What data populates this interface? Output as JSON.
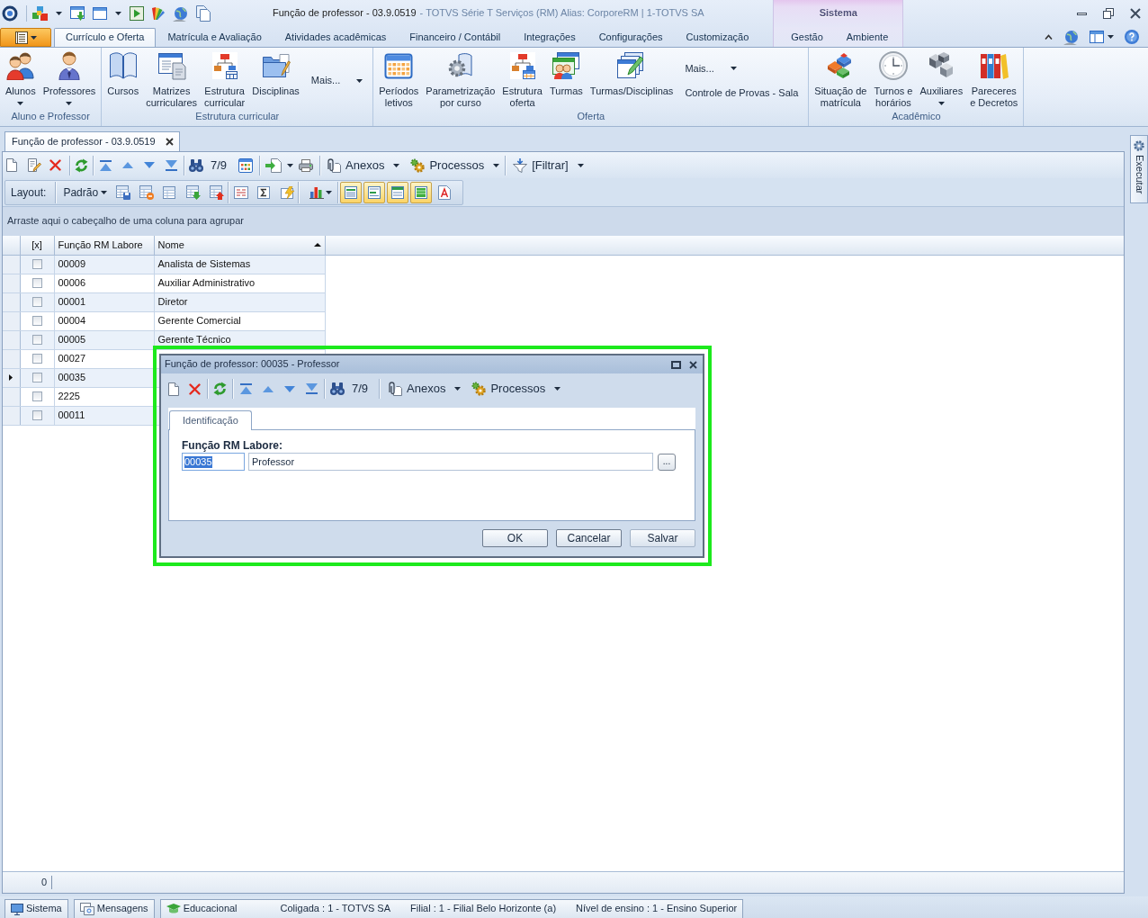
{
  "window": {
    "title": "Função de professor - 03.9.0519",
    "subtitle": "- TOTVS Série T Serviços (RM) Alias: CorporeRM | 1-TOTVS SA"
  },
  "ribbon": {
    "tabs": [
      {
        "label": "Currículo e Oferta",
        "selected": true
      },
      {
        "label": "Matrícula e Avaliação",
        "selected": false
      },
      {
        "label": "Atividades acadêmicas",
        "selected": false
      },
      {
        "label": "Financeiro / Contábil",
        "selected": false
      },
      {
        "label": "Integrações",
        "selected": false
      },
      {
        "label": "Configurações",
        "selected": false
      },
      {
        "label": "Customização",
        "selected": false
      }
    ],
    "context_group": {
      "label": "Sistema",
      "tabs": [
        {
          "label": "Gestão",
          "selected": false
        },
        {
          "label": "Ambiente",
          "selected": false
        }
      ]
    },
    "groups": [
      {
        "label": "Aluno e Professor",
        "items": [
          {
            "kind": "large",
            "label": "Alunos",
            "dropdown": true
          },
          {
            "kind": "large",
            "label": "Professores",
            "dropdown": true
          }
        ]
      },
      {
        "label": "Estrutura curricular",
        "items": [
          {
            "kind": "large",
            "label": "Cursos",
            "dropdown": false
          },
          {
            "kind": "large",
            "label": "Matrizes\ncurriculares",
            "dropdown": false
          },
          {
            "kind": "large",
            "label": "Estrutura\ncurricular",
            "dropdown": false
          },
          {
            "kind": "large",
            "label": "Disciplinas",
            "dropdown": false
          },
          {
            "kind": "stack",
            "items": [
              {
                "label": "Mais...",
                "dropdown": true
              }
            ]
          }
        ]
      },
      {
        "label": "Oferta",
        "items": [
          {
            "kind": "large",
            "label": "Períodos\nletivos",
            "dropdown": false
          },
          {
            "kind": "large",
            "label": "Parametrização\npor curso",
            "dropdown": false
          },
          {
            "kind": "large",
            "label": "Estrutura\noferta",
            "dropdown": false
          },
          {
            "kind": "large",
            "label": "Turmas",
            "dropdown": false
          },
          {
            "kind": "large",
            "label": "Turmas/Disciplinas",
            "dropdown": false
          },
          {
            "kind": "stack",
            "items": [
              {
                "label": "Mais...",
                "dropdown": true
              },
              {
                "label": "Controle de Provas - Sala",
                "dropdown": false
              }
            ]
          }
        ]
      },
      {
        "label": "Acadêmico",
        "items": [
          {
            "kind": "large",
            "label": "Situação de\nmatrícula",
            "dropdown": false
          },
          {
            "kind": "large",
            "label": "Turnos e\nhorários",
            "dropdown": false
          },
          {
            "kind": "large",
            "label": "Auxiliares",
            "dropdown": true
          },
          {
            "kind": "large",
            "label": "Pareceres\ne Decretos",
            "dropdown": false
          }
        ]
      }
    ]
  },
  "documents": [
    {
      "label": "Função de professor - 03.9.0519",
      "selected": true,
      "closable": true
    }
  ],
  "side_tabs": [
    {
      "label": "Executar"
    }
  ],
  "toolbar": {
    "record_counter": "7/9",
    "menus": [
      {
        "label": "Anexos",
        "dropdown": true
      },
      {
        "label": "Processos",
        "dropdown": true
      },
      {
        "label": "[Filtrar]",
        "dropdown": true
      }
    ]
  },
  "layout_bar": {
    "label": "Layout:",
    "layout_menu": {
      "label": "Padrão",
      "dropdown": true
    },
    "view_toggles": [
      {
        "on": true
      },
      {
        "on": true
      },
      {
        "on": true
      },
      {
        "on": true
      },
      {
        "on": false
      }
    ]
  },
  "grid": {
    "group_hint": "Arraste aqui o cabeçalho de uma coluna para agrupar",
    "columns": [
      {
        "label": "[x]",
        "sorted": false
      },
      {
        "label": "Função RM Labore",
        "sorted": false
      },
      {
        "label": "Nome",
        "sorted": true
      }
    ],
    "rows": [
      {
        "code": "00009",
        "name": "Analista de Sistemas",
        "checked": false,
        "selected": false
      },
      {
        "code": "00006",
        "name": "Auxiliar Administrativo",
        "checked": false,
        "selected": false
      },
      {
        "code": "00001",
        "name": "Diretor",
        "checked": false,
        "selected": false
      },
      {
        "code": "00004",
        "name": "Gerente Comercial",
        "checked": false,
        "selected": false
      },
      {
        "code": "00005",
        "name": "Gerente Técnico",
        "checked": false,
        "selected": false
      },
      {
        "code": "00027",
        "checked": false,
        "selected": false
      },
      {
        "code": "00035",
        "checked": false,
        "selected": true
      },
      {
        "code": "2225",
        "checked": false,
        "selected": false
      },
      {
        "code": "00011",
        "checked": false,
        "selected": false
      }
    ],
    "footer_count": "0"
  },
  "dialog": {
    "outlined": true,
    "title": "Função de professor: 00035 - Professor",
    "toolbar": {
      "record_counter": "7/9",
      "menus": [
        {
          "label": "Anexos",
          "dropdown": true
        },
        {
          "label": "Processos",
          "dropdown": true
        }
      ]
    },
    "tabs": [
      {
        "label": "Identificação",
        "selected": true
      }
    ],
    "field_label": "Função RM Labore:",
    "code_field": {
      "value": "00035",
      "highlighted": true
    },
    "name_field": {
      "value": "Professor"
    },
    "lookup_button": "...",
    "buttons": [
      {
        "label": "OK"
      },
      {
        "label": "Cancelar"
      },
      {
        "label": "Salvar"
      }
    ]
  },
  "status_bar": {
    "buttons": [
      {
        "label": "Sistema"
      },
      {
        "label": "Mensagens"
      }
    ],
    "module": "Educacional",
    "info": [
      "Coligada : 1 - TOTVS SA",
      "Filial : 1 - Filial Belo Horizonte (a)",
      "Nível de ensino : 1 - Ensino Superior"
    ]
  }
}
